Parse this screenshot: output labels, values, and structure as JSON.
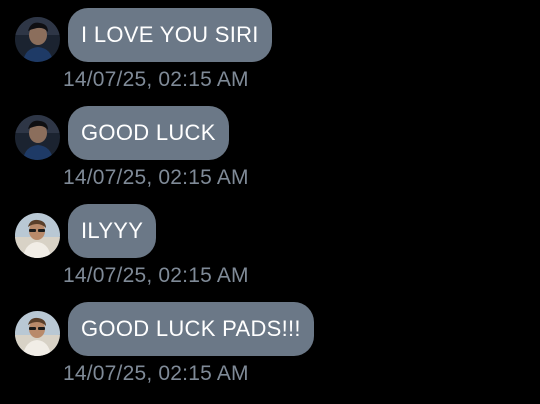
{
  "colors": {
    "background": "#000000",
    "bubble": "#6b7887",
    "bubble_text": "#ffffff",
    "timestamp": "#7f8a97"
  },
  "messages": [
    {
      "sender_avatar": "avatar-dark-selfie",
      "text": "I LOVE YOU SIRI",
      "timestamp": "14/07/25, 02:15 AM"
    },
    {
      "sender_avatar": "avatar-dark-selfie",
      "text": "GOOD LUCK",
      "timestamp": "14/07/25, 02:15 AM"
    },
    {
      "sender_avatar": "avatar-beach-sunglasses",
      "text": "ILYYY",
      "timestamp": "14/07/25, 02:15 AM"
    },
    {
      "sender_avatar": "avatar-beach-sunglasses",
      "text": "GOOD LUCK PADS!!!",
      "timestamp": "14/07/25, 02:15 AM"
    }
  ]
}
